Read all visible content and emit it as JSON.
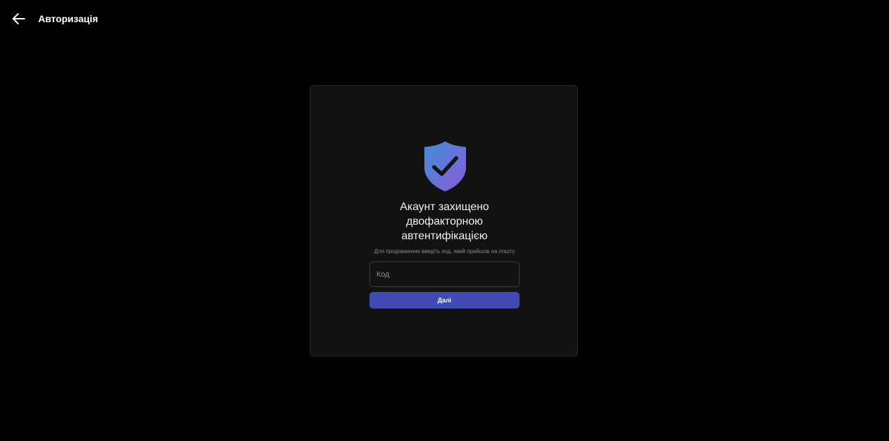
{
  "header": {
    "title": "Авторизація",
    "back_icon": "arrow-left-icon"
  },
  "card": {
    "icon": "shield-check-icon",
    "heading_lines": [
      "Акаунт захищено",
      "двофакторною",
      "автентифікацією"
    ],
    "hint": "Для продовження введіть код, який прийшов на пошту",
    "code_input": {
      "placeholder": "Код",
      "value": ""
    },
    "next_label": "Далі"
  },
  "colors": {
    "background": "#000000",
    "card": "#121212",
    "button": "#3f4bb3",
    "shield_gradient_start": "#3f8fd8",
    "shield_gradient_end": "#8a5ad6"
  }
}
